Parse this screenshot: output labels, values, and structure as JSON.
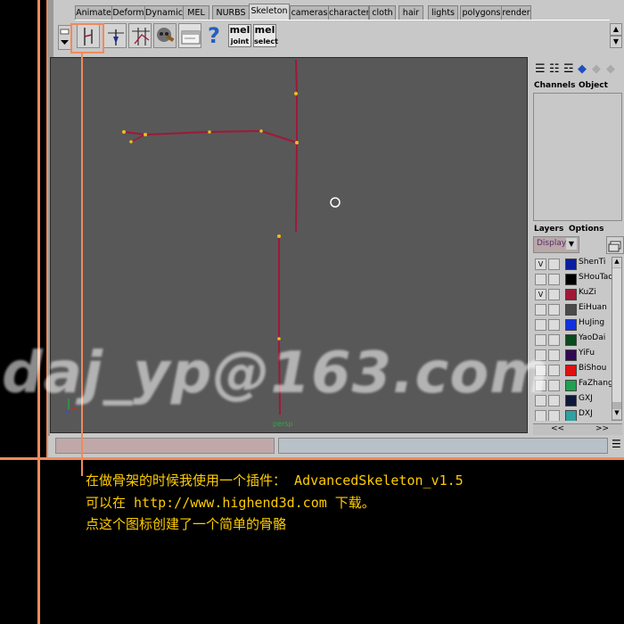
{
  "shelf_tabs": [
    "Animate",
    "Deform",
    "Dynamic",
    "MEL",
    "NURBS",
    "Skeleton",
    "cameras",
    "character",
    "cloth",
    "hair",
    "lights",
    "polygons",
    "render"
  ],
  "active_tab": "Skeleton",
  "shelf_tools": {
    "joint_tool_icon": "joint-tool-icon",
    "ik_handle_icon": "ik-handle-icon",
    "ik_spline_icon": "ik-spline-icon",
    "help_label": "?",
    "mel_joint": {
      "top": "mel",
      "bottom": "joint"
    },
    "mel_select": {
      "top": "mel",
      "bottom": "select"
    }
  },
  "viewport": {
    "camera_label": "persp",
    "axis_z": "z",
    "skeleton_color": "#a01838",
    "joint_color": "#e8c020"
  },
  "channels_box": {
    "channels": "Channels",
    "object": "Object"
  },
  "layers_panel": {
    "layers": "Layers",
    "options": "Options",
    "display_value": "Display",
    "items": [
      {
        "name": "ShenTi",
        "visible": "V",
        "color": "#0a1ea0"
      },
      {
        "name": "SHouTao",
        "visible": "",
        "color": "#000000"
      },
      {
        "name": "KuZi",
        "visible": "V",
        "color": "#a01838"
      },
      {
        "name": "EiHuan",
        "visible": "",
        "color": "#4a4a4a"
      },
      {
        "name": "HuJing",
        "visible": "",
        "color": "#1030e0"
      },
      {
        "name": "YaoDai",
        "visible": "",
        "color": "#0a4a1e"
      },
      {
        "name": "YiFu",
        "visible": "",
        "color": "#300a50"
      },
      {
        "name": "BiShou",
        "visible": "",
        "color": "#e01010"
      },
      {
        "name": "FaZhang",
        "visible": "",
        "color": "#20a050"
      },
      {
        "name": "GXJ",
        "visible": "",
        "color": "#10183a"
      },
      {
        "name": "DXJ",
        "visible": "",
        "color": "#30a0a0"
      }
    ],
    "nav_prev": "<<",
    "nav_next": ">>"
  },
  "annotation": {
    "line1": "在做骨架的时候我使用一个插件： AdvancedSkeleton_v1.5",
    "line2": "可以在 http://www.highend3d.com 下载。",
    "line3": "点这个图标创建了一个简单的骨骼"
  },
  "watermark": "daj_yp@163.com",
  "colors": {
    "highlight": "#f08a5c",
    "annotation_text": "#ffcc00"
  }
}
